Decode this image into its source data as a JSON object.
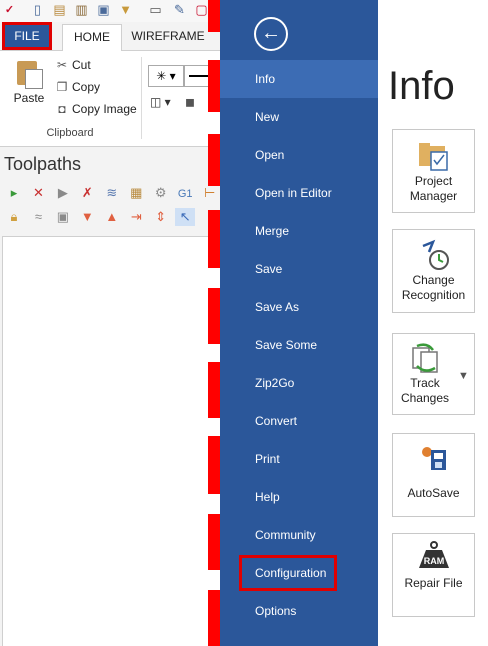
{
  "ribbon": {
    "tabs": {
      "file": "FILE",
      "home": "HOME",
      "wireframe": "WIREFRAME"
    },
    "clipboard": {
      "paste": "Paste",
      "cut": "Cut",
      "copy": "Copy",
      "copy_image": "Copy Image",
      "group_label": "Clipboard"
    }
  },
  "toolpaths": {
    "title": "Toolpaths",
    "g1_label": "G1"
  },
  "file_menu": {
    "back_icon": "←",
    "items": [
      "Info",
      "New",
      "Open",
      "Open in Editor",
      "Merge",
      "Save",
      "Save As",
      "Save Some",
      "Zip2Go",
      "Convert",
      "Print",
      "Help",
      "Community",
      "Configuration",
      "Options"
    ],
    "active": "Info",
    "highlighted": "Configuration"
  },
  "info": {
    "title": "Info",
    "cards": {
      "project_manager": "Project Manager",
      "change_recognition": "Change Recognition",
      "track_changes": "Track Changes",
      "autosave": "AutoSave",
      "repair_file": "Repair File",
      "ram_badge": "RAM"
    }
  },
  "colors": {
    "menu_bg": "#2b579a",
    "menu_active": "#3c6cb4",
    "highlight": "#e00000",
    "redaction": "#ff0000"
  }
}
